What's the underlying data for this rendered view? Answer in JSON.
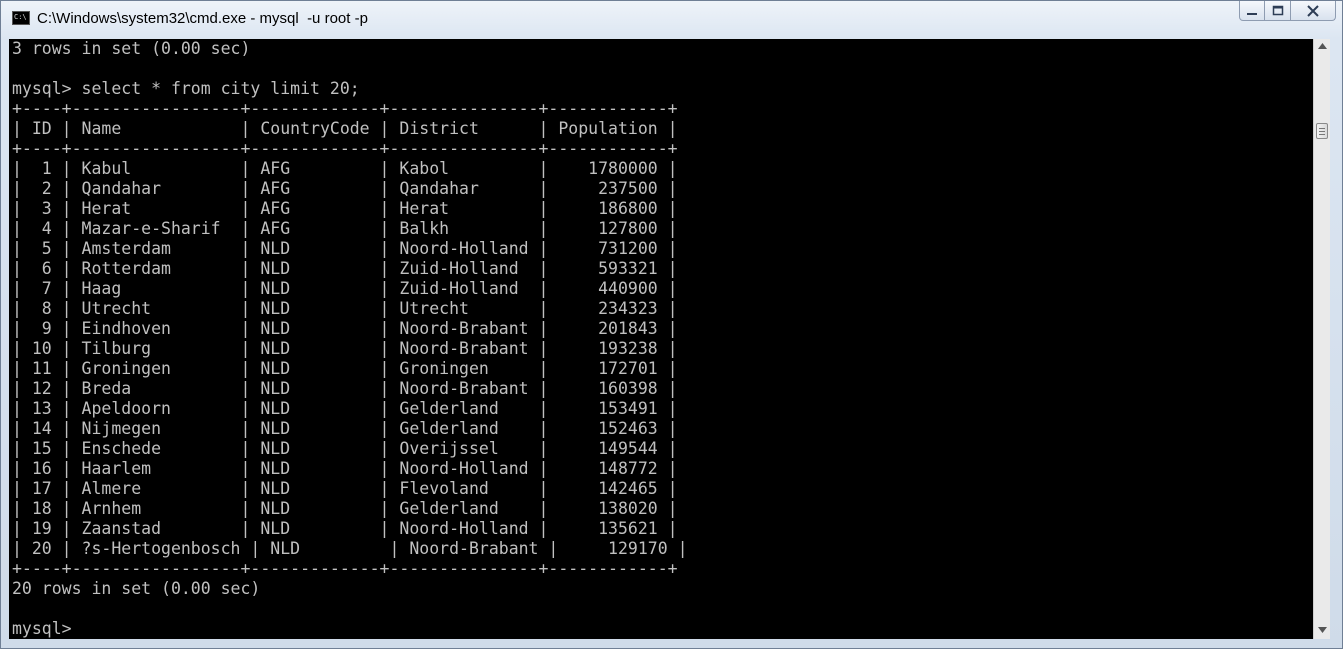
{
  "window": {
    "title": "C:\\Windows\\system32\\cmd.exe - mysql  -u root -p",
    "icon": "cmd-console-icon",
    "icon_text": "C:\\"
  },
  "caption_buttons": {
    "minimize": "minimize-icon",
    "maximize": "maximize-icon",
    "close": "close-icon"
  },
  "console": {
    "lines": [
      "3 rows in set (0.00 sec)",
      "",
      "mysql> select * from city limit 20;",
      "+----+-----------------+-------------+---------------+------------+",
      "| ID | Name            | CountryCode | District      | Population |",
      "+----+-----------------+-------------+---------------+------------+",
      "|  1 | Kabul           | AFG         | Kabol         |    1780000 |",
      "|  2 | Qandahar        | AFG         | Qandahar      |     237500 |",
      "|  3 | Herat           | AFG         | Herat         |     186800 |",
      "|  4 | Mazar-e-Sharif  | AFG         | Balkh         |     127800 |",
      "|  5 | Amsterdam       | NLD         | Noord-Holland |     731200 |",
      "|  6 | Rotterdam       | NLD         | Zuid-Holland  |     593321 |",
      "|  7 | Haag            | NLD         | Zuid-Holland  |     440900 |",
      "|  8 | Utrecht         | NLD         | Utrecht       |     234323 |",
      "|  9 | Eindhoven       | NLD         | Noord-Brabant |     201843 |",
      "| 10 | Tilburg         | NLD         | Noord-Brabant |     193238 |",
      "| 11 | Groningen       | NLD         | Groningen     |     172701 |",
      "| 12 | Breda           | NLD         | Noord-Brabant |     160398 |",
      "| 13 | Apeldoorn       | NLD         | Gelderland    |     153491 |",
      "| 14 | Nijmegen        | NLD         | Gelderland    |     152463 |",
      "| 15 | Enschede        | NLD         | Overijssel    |     149544 |",
      "| 16 | Haarlem         | NLD         | Noord-Holland |     148772 |",
      "| 17 | Almere          | NLD         | Flevoland     |     142465 |",
      "| 18 | Arnhem          | NLD         | Gelderland    |     138020 |",
      "| 19 | Zaanstad        | NLD         | Noord-Holland |     135621 |",
      "| 20 | ?s-Hertogenbosch | NLD         | Noord-Brabant |     129170 |",
      "+----+-----------------+-------------+---------------+------------+",
      "20 rows in set (0.00 sec)",
      "",
      "mysql>"
    ]
  },
  "scrollbar": {
    "up_arrow": "scroll-up-arrow-icon",
    "down_arrow": "scroll-down-arrow-icon",
    "thumb_grip": "scroll-thumb-grip-icon"
  }
}
